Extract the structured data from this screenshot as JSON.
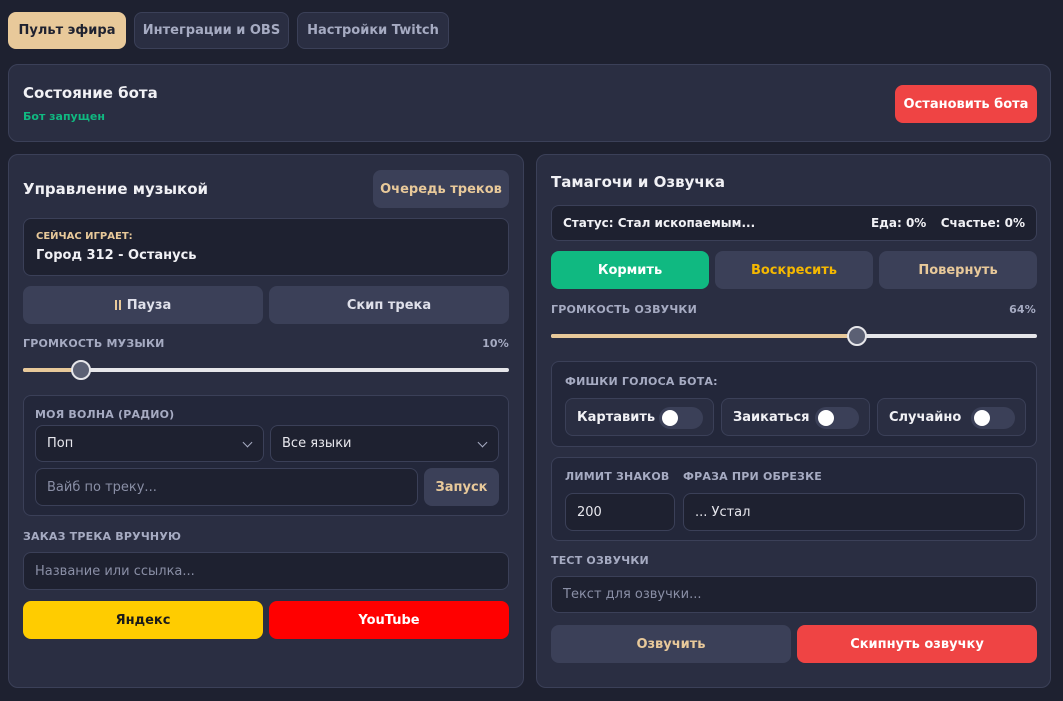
{
  "tabs": [
    {
      "label": "Пульт эфира",
      "active": true
    },
    {
      "label": "Интеграции и OBS",
      "active": false
    },
    {
      "label": "Настройки Twitch",
      "active": false
    }
  ],
  "bot_status": {
    "title": "Состояние бота",
    "status": "Бот запущен",
    "stop_label": "Остановить бота"
  },
  "music": {
    "title": "Управление музыкой",
    "queue_label": "Очередь треков",
    "now_playing_label": "СЕЙЧАС ИГРАЕТ:",
    "now_playing_track": "Город 312 - Останусь",
    "pause_label": "Пауза",
    "skip_label": "Скип трека",
    "volume_label": "ГРОМКОСТЬ МУЗЫКИ",
    "volume_value": "10%",
    "volume_fraction": 0.12,
    "wave_label": "МОЯ ВОЛНА (РАДИО)",
    "genre_selected": "Поп",
    "language_selected": "Все языки",
    "vibe_placeholder": "Вайб по треку...",
    "launch_label": "Запуск",
    "order_label": "ЗАКАЗ ТРЕКА ВРУЧНУЮ",
    "order_placeholder": "Название или ссылка...",
    "yandex_label": "Яндекс",
    "youtube_label": "YouTube"
  },
  "tamagotchi": {
    "title": "Тамагочи и Озвучка",
    "status_text": "Статус: Стал ископаемым...",
    "food_text": "Еда: 0%",
    "happiness_text": "Счастье: 0%",
    "feed_label": "Кормить",
    "revive_label": "Воскресить",
    "turn_label": "Повернуть",
    "tts_volume_label": "ГРОМКОСТЬ ОЗВУЧКИ",
    "tts_volume_value": "64%",
    "tts_volume_fraction": 0.63,
    "voice_features_label": "ФИШКИ ГОЛОСА БОТА:",
    "toggles": [
      {
        "label": "Картавить",
        "on": false
      },
      {
        "label": "Заикаться",
        "on": false
      },
      {
        "label": "Случайно",
        "on": false
      }
    ],
    "char_limit_label": "ЛИМИТ ЗНАКОВ",
    "char_limit_value": "200",
    "trim_phrase_label": "ФРАЗА ПРИ ОБРЕЗКЕ",
    "trim_phrase_value": "... Устал",
    "test_label": "ТЕСТ ОЗВУЧКИ",
    "test_placeholder": "Текст для озвучки...",
    "speak_label": "Озвучить",
    "skip_tts_label": "Скипнуть озвучку"
  },
  "colors": {
    "background": "#1e2130",
    "card": "#2a2e42",
    "accent_beige": "#e8c99a",
    "red": "#ef4444",
    "green": "#10b981",
    "yandex_yellow": "#ffcc00",
    "youtube_red": "#ff0000"
  }
}
